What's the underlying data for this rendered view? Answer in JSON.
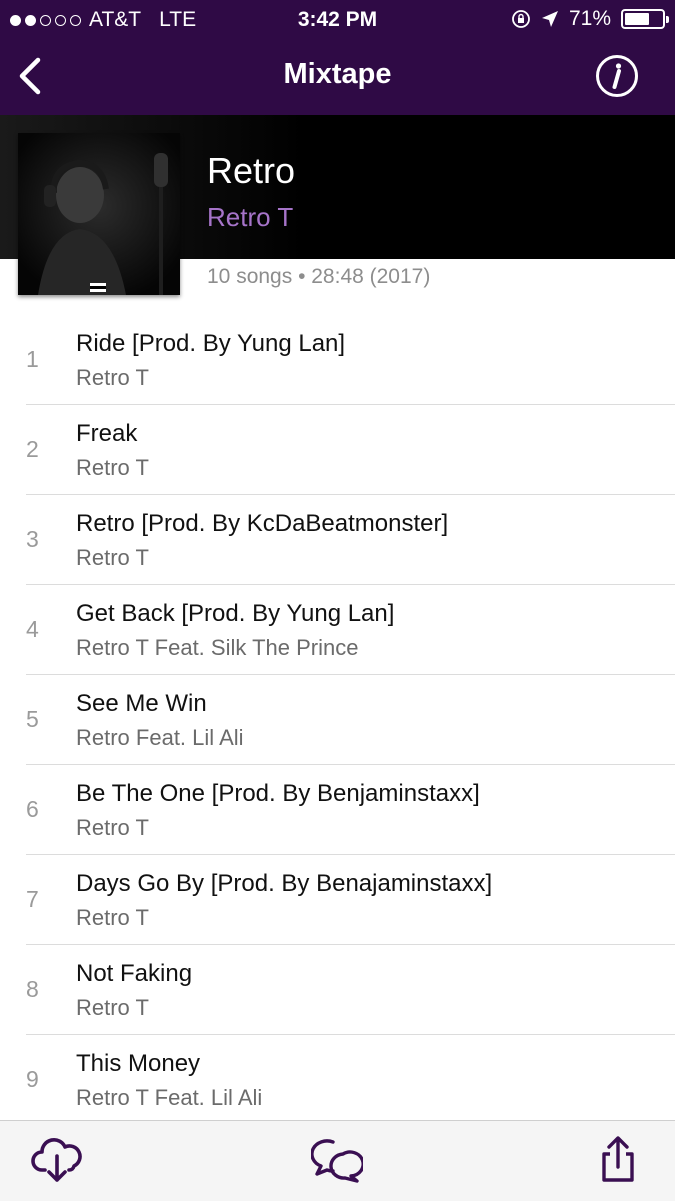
{
  "status_bar": {
    "carrier": "AT&T",
    "network": "LTE",
    "time": "3:42 PM",
    "battery": "71%",
    "battery_level": 0.71,
    "signal_bars_filled": 2,
    "signal_bars_total": 5
  },
  "nav": {
    "title": "Mixtape",
    "back_icon": "chevron-left-icon",
    "info_icon": "info-icon"
  },
  "album": {
    "title": "Retro",
    "artist": "Retro T",
    "meta": "10 songs • 28:48 (2017)",
    "advisory_label": "PARENTAL ADVISORY"
  },
  "tracks": [
    {
      "number": "1",
      "title": "Ride [Prod. By Yung Lan]",
      "artist": "Retro T"
    },
    {
      "number": "2",
      "title": "Freak",
      "artist": "Retro T"
    },
    {
      "number": "3",
      "title": "Retro [Prod. By KcDaBeatmonster]",
      "artist": "Retro T"
    },
    {
      "number": "4",
      "title": "Get Back [Prod. By Yung Lan]",
      "artist": "Retro T Feat. Silk The Prince"
    },
    {
      "number": "5",
      "title": "See Me Win",
      "artist": "Retro Feat. Lil Ali"
    },
    {
      "number": "6",
      "title": "Be The One [Prod. By Benjaminstaxx]",
      "artist": "Retro T"
    },
    {
      "number": "7",
      "title": "Days Go By [Prod. By Benajaminstaxx]",
      "artist": "Retro T"
    },
    {
      "number": "8",
      "title": "Not Faking",
      "artist": "Retro T"
    },
    {
      "number": "9",
      "title": "This Money",
      "artist": "Retro T Feat. Lil Ali"
    }
  ],
  "toolbar": {
    "icons": [
      "cloud-download-icon",
      "comments-icon",
      "share-icon"
    ]
  },
  "colors": {
    "nav_background": "#2f0a45",
    "accent": "#a674c9",
    "icon": "#3a0f52"
  }
}
